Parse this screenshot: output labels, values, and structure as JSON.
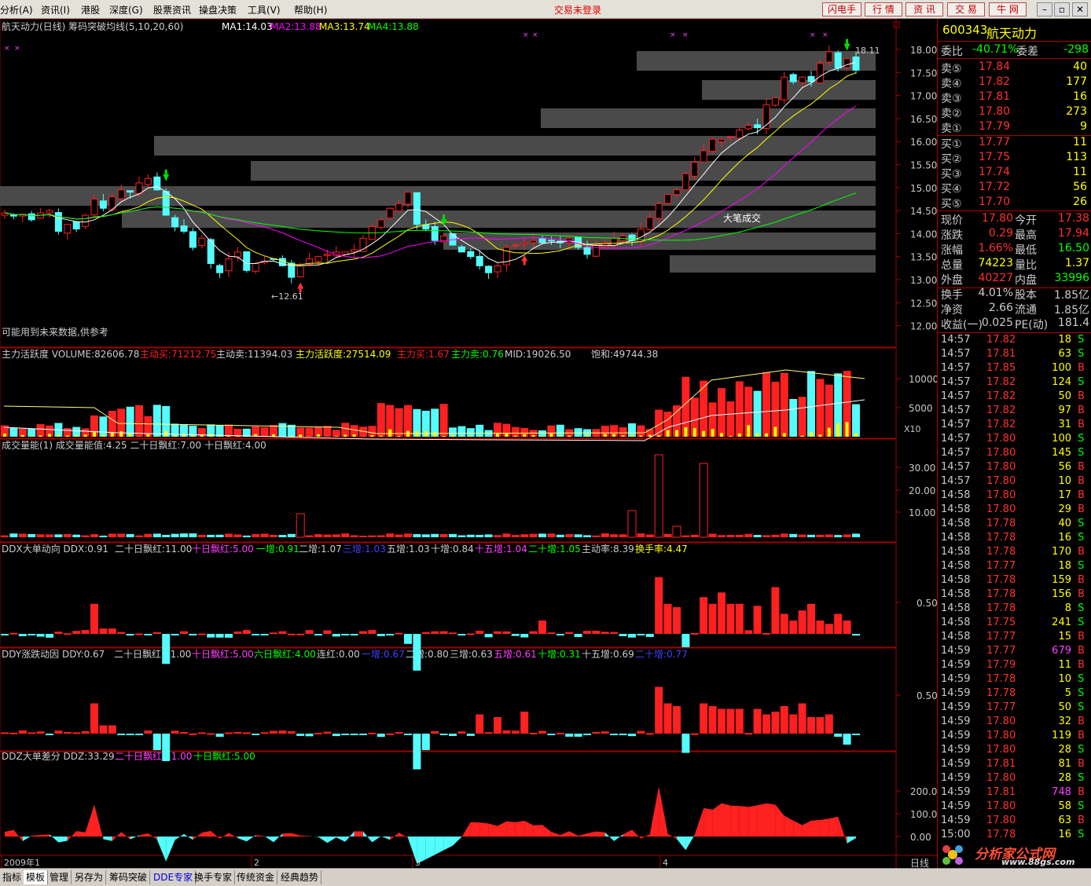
{
  "menu": {
    "items": [
      "分析(A)",
      "资讯(I)",
      "港股",
      "深度(G)",
      "股票资讯",
      "操盘决策",
      "工具(V)",
      "帮助(H)"
    ],
    "status": "交易未登录",
    "right_buttons": [
      "闪电手",
      "行 情",
      "资 讯",
      "交 易",
      "牛 网"
    ],
    "win": [
      "–",
      "▫",
      "✕"
    ]
  },
  "main": {
    "title": "航天动力(日线) 筹码突破均线(5,10,20,60)",
    "ma": [
      "MA1:14.03",
      "MA2:13.88",
      "MA3:13.74",
      "MA4:13.88"
    ],
    "note": "可能用到未来数据,供参考",
    "ann_big": "大笔成交",
    "ann_low": "←12.61",
    "ann_high": "18.11",
    "yticks": [
      "18.00",
      "17.50",
      "17.00",
      "16.50",
      "16.00",
      "15.50",
      "15.00",
      "14.50",
      "14.00",
      "13.50",
      "13.00",
      "12.50",
      "12.00"
    ]
  },
  "p1": {
    "title": "主力活跃度 VOLUME:82606.78",
    "items": [
      "主动买:71212.75",
      "主动卖:11394.03",
      "主力活跃度:27514.09",
      "主力买:1.67",
      "主力卖:0.76",
      "MID:19026.50",
      "饱和:49744.38"
    ],
    "yticks": [
      "10000",
      "5000"
    ],
    "unit": "X10"
  },
  "p2": {
    "title": "成交量能(1) 成交量能值:4.25 二十日飘红:7.00 十日飘红:4.00",
    "yticks": [
      "30.00",
      "20.00",
      "10.00"
    ]
  },
  "p3": {
    "title": "DDX大单动向 DDX:0.91",
    "items": [
      "二十日飘红:11.00",
      "十日飘红:5.00",
      "一增:0.91",
      "二增:1.07",
      "三增:1.03",
      "五增:1.03",
      "十增:0.84",
      "十五增:1.04",
      "二十增:1.05",
      "主动率:8.39",
      "换手率:4.47"
    ],
    "yticks": [
      "0.50"
    ]
  },
  "p4": {
    "title": "DDY涨跌动因 DDY:0.67",
    "items": [
      "二十日飘红:11.00",
      "十日飘红:5.00",
      "六日飘红:4.00",
      "连红:0.00",
      "一增:0.67",
      "二增:0.80",
      "三增:0.63",
      "五增:0.61",
      "十增:0.31",
      "十五增:0.69",
      "二十增:0.77"
    ],
    "yticks": [
      "0.50"
    ]
  },
  "p5": {
    "title": "DDZ大单差分 DDZ:33.29",
    "items": [
      "二十日飘红:11.00",
      "十日飘红:5.00"
    ],
    "yticks": [
      "200.0",
      "100.0",
      "0.00"
    ]
  },
  "xaxis": {
    "labels": [
      "2009年1",
      "2",
      "3",
      "4"
    ],
    "period": "日线"
  },
  "quote": {
    "code": "600343",
    "name": "航天动力",
    "webi_label": "委比",
    "webi": "-40.71%",
    "weicha_label": "委差",
    "weicha": "-298",
    "asks": [
      {
        "l": "卖⑤",
        "p": "17.84",
        "v": "40"
      },
      {
        "l": "卖④",
        "p": "17.82",
        "v": "177"
      },
      {
        "l": "卖③",
        "p": "17.81",
        "v": "16"
      },
      {
        "l": "卖②",
        "p": "17.80",
        "v": "273"
      },
      {
        "l": "卖①",
        "p": "17.79",
        "v": "9"
      }
    ],
    "bids": [
      {
        "l": "买①",
        "p": "17.77",
        "v": "11"
      },
      {
        "l": "买②",
        "p": "17.75",
        "v": "113"
      },
      {
        "l": "买③",
        "p": "17.74",
        "v": "11"
      },
      {
        "l": "买④",
        "p": "17.72",
        "v": "56"
      },
      {
        "l": "买⑤",
        "p": "17.70",
        "v": "26"
      }
    ],
    "stats": [
      [
        "现价",
        "17.80",
        "今开",
        "17.38"
      ],
      [
        "涨跌",
        "0.29",
        "最高",
        "17.94"
      ],
      [
        "涨幅",
        "1.66%",
        "最低",
        "16.50"
      ],
      [
        "总量",
        "74223",
        "量比",
        "1.37"
      ],
      [
        "外盘",
        "40227",
        "内盘",
        "33996"
      ],
      [
        "换手",
        "4.01%",
        "股本",
        "1.85亿"
      ],
      [
        "净资",
        "2.66",
        "流通",
        "1.85亿"
      ],
      [
        "收益(一)",
        "0.025",
        "PE(动)",
        "181.4"
      ]
    ]
  },
  "ticks": [
    [
      "14:57",
      "17.82",
      "18",
      "S"
    ],
    [
      "14:57",
      "17.81",
      "63",
      "S"
    ],
    [
      "14:57",
      "17.85",
      "100",
      "B"
    ],
    [
      "14:57",
      "17.82",
      "124",
      "S"
    ],
    [
      "14:57",
      "17.82",
      "50",
      "B"
    ],
    [
      "14:57",
      "17.82",
      "97",
      "B"
    ],
    [
      "14:57",
      "17.82",
      "31",
      "B"
    ],
    [
      "14:57",
      "17.80",
      "100",
      "S"
    ],
    [
      "14:57",
      "17.80",
      "145",
      "S"
    ],
    [
      "14:57",
      "17.80",
      "56",
      "B"
    ],
    [
      "14:57",
      "17.80",
      "10",
      "B"
    ],
    [
      "14:58",
      "17.80",
      "17",
      "B"
    ],
    [
      "14:58",
      "17.80",
      "29",
      "B"
    ],
    [
      "14:58",
      "17.78",
      "40",
      "S"
    ],
    [
      "14:58",
      "17.78",
      "16",
      "S"
    ],
    [
      "14:58",
      "17.78",
      "170",
      "B"
    ],
    [
      "14:58",
      "17.77",
      "18",
      "S"
    ],
    [
      "14:58",
      "17.78",
      "159",
      "B"
    ],
    [
      "14:58",
      "17.78",
      "156",
      "B"
    ],
    [
      "14:58",
      "17.78",
      "8",
      "S"
    ],
    [
      "14:58",
      "17.75",
      "241",
      "S"
    ],
    [
      "14:58",
      "17.77",
      "15",
      "B"
    ],
    [
      "14:59",
      "17.77",
      "679",
      "B"
    ],
    [
      "14:59",
      "17.79",
      "11",
      "B"
    ],
    [
      "14:59",
      "17.78",
      "10",
      "S"
    ],
    [
      "14:59",
      "17.78",
      "5",
      "S"
    ],
    [
      "14:59",
      "17.77",
      "50",
      "S"
    ],
    [
      "14:59",
      "17.80",
      "32",
      "B"
    ],
    [
      "14:59",
      "17.80",
      "119",
      "B"
    ],
    [
      "14:59",
      "17.80",
      "28",
      "S"
    ],
    [
      "14:59",
      "17.81",
      "81",
      "B"
    ],
    [
      "14:59",
      "17.80",
      "28",
      "S"
    ],
    [
      "14:59",
      "17.81",
      "748",
      "B"
    ],
    [
      "14:59",
      "17.80",
      "58",
      "S"
    ],
    [
      "14:59",
      "17.80",
      "63",
      "B"
    ],
    [
      "15:00",
      "17.78",
      "16",
      "S"
    ]
  ],
  "tabs": [
    "指标",
    "模板",
    "管理",
    "另存为",
    "筹码突破",
    "DDE专家",
    "换手专家",
    "传统资金",
    "经典趋势"
  ],
  "logo": {
    "text": "分析家公式网",
    "url": "www.88gs.com"
  },
  "colors": {
    "up": "#ff2020",
    "down": "#54fcfc",
    "ma1": "#ffffff",
    "ma2": "#ffff00",
    "ma3": "#ff00ff",
    "ma4": "#00ff00"
  }
}
